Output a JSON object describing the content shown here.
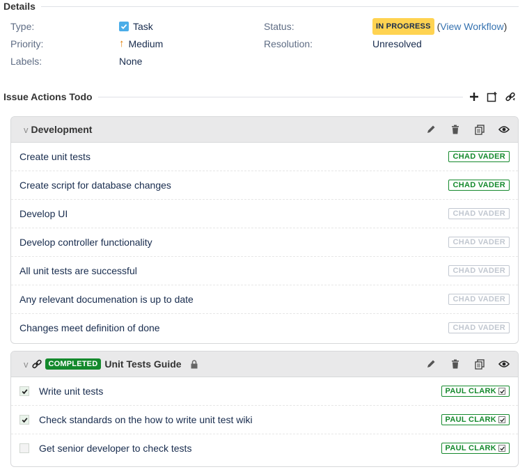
{
  "details": {
    "title": "Details",
    "type_label": "Type:",
    "type_value": "Task",
    "priority_label": "Priority:",
    "priority_value": "Medium",
    "labels_label": "Labels:",
    "labels_value": "None",
    "status_label": "Status:",
    "status_value": "IN PROGRESS",
    "status_open_paren": "(",
    "status_link": "View Workflow",
    "status_close_paren": ")",
    "resolution_label": "Resolution:",
    "resolution_value": "Unresolved"
  },
  "actions": {
    "title": "Issue Actions Todo",
    "icons": [
      "plus-icon",
      "add-checklist-icon",
      "link-icon"
    ]
  },
  "panels": [
    {
      "chevron": "v",
      "title": "Development",
      "items": [
        {
          "text": "Create unit tests",
          "assignee": "CHAD VADER",
          "active": true
        },
        {
          "text": "Create script for database changes",
          "assignee": "CHAD VADER",
          "active": true
        },
        {
          "text": "Develop UI",
          "assignee": "CHAD VADER",
          "active": false
        },
        {
          "text": "Develop controller functionality",
          "assignee": "CHAD VADER",
          "active": false
        },
        {
          "text": "All unit tests are successful",
          "assignee": "CHAD VADER",
          "active": false
        },
        {
          "text": "Any relevant documenation is up to date",
          "assignee": "CHAD VADER",
          "active": false
        },
        {
          "text": "Changes meet definition of done",
          "assignee": "CHAD VADER",
          "active": false
        }
      ]
    },
    {
      "chevron": "v",
      "status": "COMPLETED",
      "title": "Unit Tests Guide",
      "items": [
        {
          "text": "Write unit tests",
          "assignee": "PAUL CLARK",
          "checked": true
        },
        {
          "text": "Check standards on the how to write unit test wiki",
          "assignee": "PAUL CLARK",
          "checked": true
        },
        {
          "text": "Get senior developer to check tests",
          "assignee": "PAUL CLARK",
          "checked": false
        }
      ]
    }
  ],
  "colors": {
    "status_inprogress": "#ffd351",
    "completed": "#14892c",
    "link": "#3572b0",
    "assignee_active": "#14892c",
    "assignee_inactive": "#c1c7d0"
  }
}
